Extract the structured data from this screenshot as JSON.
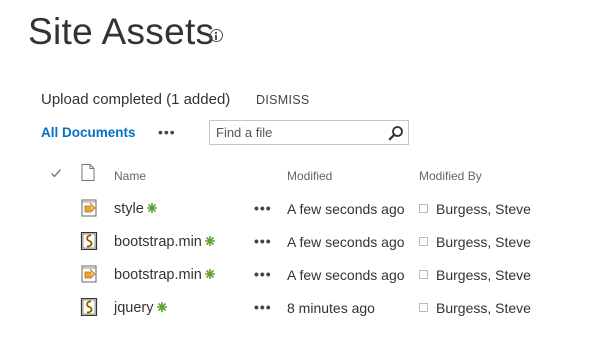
{
  "page": {
    "title": "Site Assets"
  },
  "notification": {
    "message": "Upload completed (1 added)",
    "dismiss_label": "DISMISS"
  },
  "view": {
    "name": "All Documents",
    "more": "•••"
  },
  "search": {
    "placeholder": "Find a file",
    "value": ""
  },
  "columns": {
    "name": "Name",
    "modified": "Modified",
    "modified_by": "Modified By"
  },
  "colors": {
    "accent": "#0072c6",
    "new_badge": "#5ca532"
  },
  "files": [
    {
      "name": "style",
      "type": "css-file-icon",
      "is_new": true,
      "modified": "A few seconds ago",
      "modified_by": "Burgess, Steve",
      "more": "•••"
    },
    {
      "name": "bootstrap.min",
      "type": "js-file-icon",
      "is_new": true,
      "modified": "A few seconds ago",
      "modified_by": "Burgess, Steve",
      "more": "•••"
    },
    {
      "name": "bootstrap.min",
      "type": "css-file-icon",
      "is_new": true,
      "modified": "A few seconds ago",
      "modified_by": "Burgess, Steve",
      "more": "•••"
    },
    {
      "name": "jquery",
      "type": "js-file-icon",
      "is_new": true,
      "modified": "8 minutes ago",
      "modified_by": "Burgess, Steve",
      "more": "•••"
    }
  ]
}
